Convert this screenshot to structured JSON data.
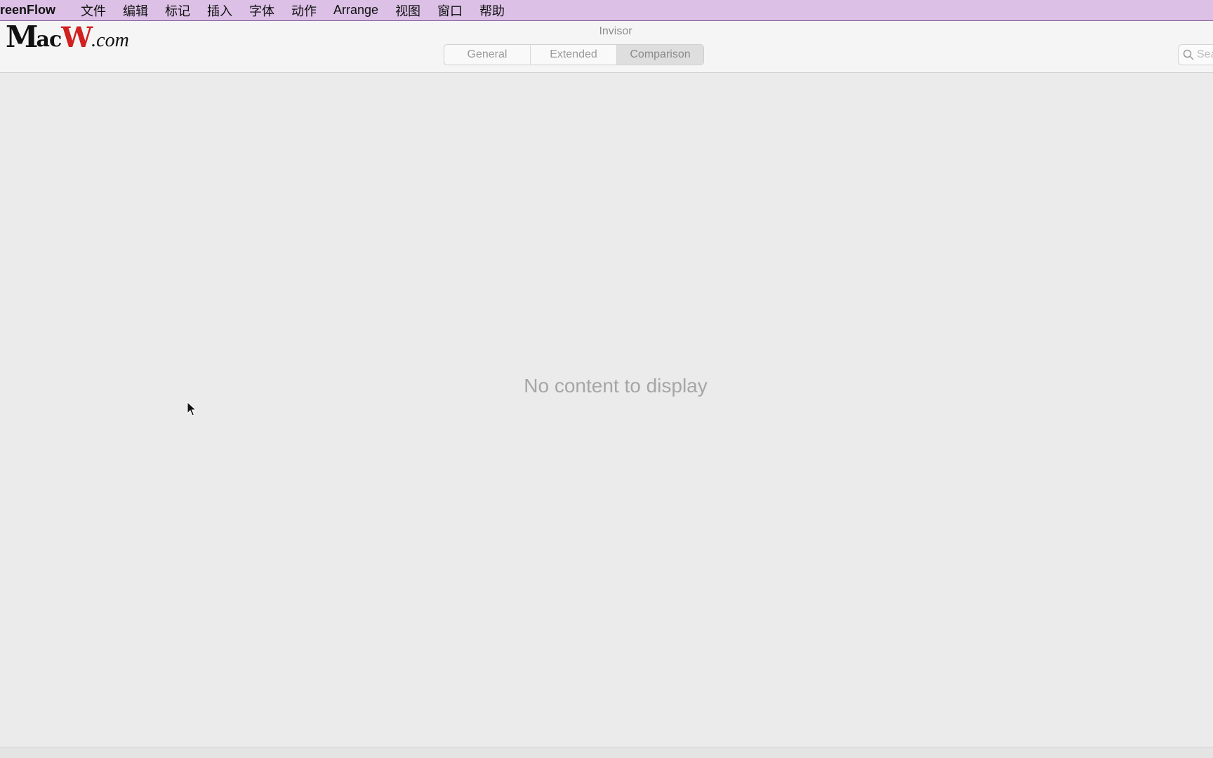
{
  "menubar": {
    "app_name": "reenFlow",
    "items": [
      "文件",
      "编辑",
      "标记",
      "插入",
      "字体",
      "动作",
      "Arrange",
      "视图",
      "窗口",
      "帮助"
    ]
  },
  "logo": {
    "text_m": "M",
    "text_ac": "ac",
    "text_w": "W",
    "text_com": ".com"
  },
  "window": {
    "title": "Invisor"
  },
  "tabs": [
    {
      "label": "General",
      "active": false
    },
    {
      "label": "Extended",
      "active": false
    },
    {
      "label": "Comparison",
      "active": true
    }
  ],
  "search": {
    "placeholder": "Search",
    "icon": "search-icon"
  },
  "main": {
    "empty_message": "No content to display"
  },
  "colors": {
    "menubar": "#dcc0e6",
    "background": "#ebebeb",
    "logo_accent": "#d21f1f"
  }
}
